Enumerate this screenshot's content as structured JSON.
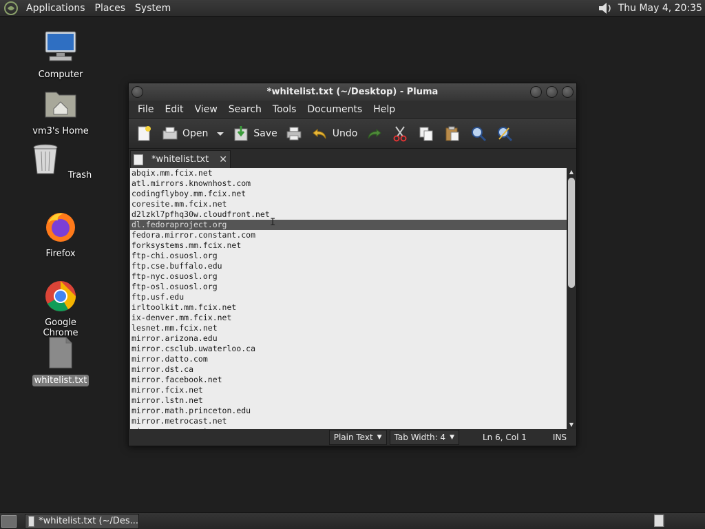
{
  "top_panel": {
    "menus": [
      "Applications",
      "Places",
      "System"
    ],
    "clock": "Thu May  4, 20:35"
  },
  "desktop_icons": [
    {
      "label": "Computer"
    },
    {
      "label": "vm3's Home"
    },
    {
      "label": "Trash"
    },
    {
      "label": "Firefox"
    },
    {
      "label": "Google Chrome"
    },
    {
      "label": "whitelist.txt"
    }
  ],
  "window": {
    "title": "*whitelist.txt (~/Desktop) - Pluma",
    "menus": [
      "File",
      "Edit",
      "View",
      "Search",
      "Tools",
      "Documents",
      "Help"
    ],
    "toolbar": {
      "open_label": "Open",
      "save_label": "Save",
      "undo_label": "Undo"
    },
    "tab_label": "*whitelist.txt",
    "lines": [
      "abqix.mm.fcix.net",
      "atl.mirrors.knownhost.com",
      "codingflyboy.mm.fcix.net",
      "coresite.mm.fcix.net",
      "d2lzkl7pfhq30w.cloudfront.net",
      "dl.fedoraproject.org",
      "fedora.mirror.constant.com",
      "forksystems.mm.fcix.net",
      "ftp-chi.osuosl.org",
      "ftp.cse.buffalo.edu",
      "ftp-nyc.osuosl.org",
      "ftp-osl.osuosl.org",
      "ftp.usf.edu",
      "irltoolkit.mm.fcix.net",
      "ix-denver.mm.fcix.net",
      "lesnet.mm.fcix.net",
      "mirror.arizona.edu",
      "mirror.csclub.uwaterloo.ca",
      "mirror.datto.com",
      "mirror.dst.ca",
      "mirror.facebook.net",
      "mirror.fcix.net",
      "mirror.lstn.net",
      "mirror.math.princeton.edu",
      "mirror.metrocast.net",
      "mirror.servaxnet.com"
    ],
    "current_line_index": 5,
    "status": {
      "language": "Plain Text",
      "tab_width": "Tab Width:  4",
      "position": "Ln 6, Col 1",
      "mode": "INS"
    }
  },
  "bottom_panel": {
    "task_label": "*whitelist.txt (~/Des..."
  }
}
